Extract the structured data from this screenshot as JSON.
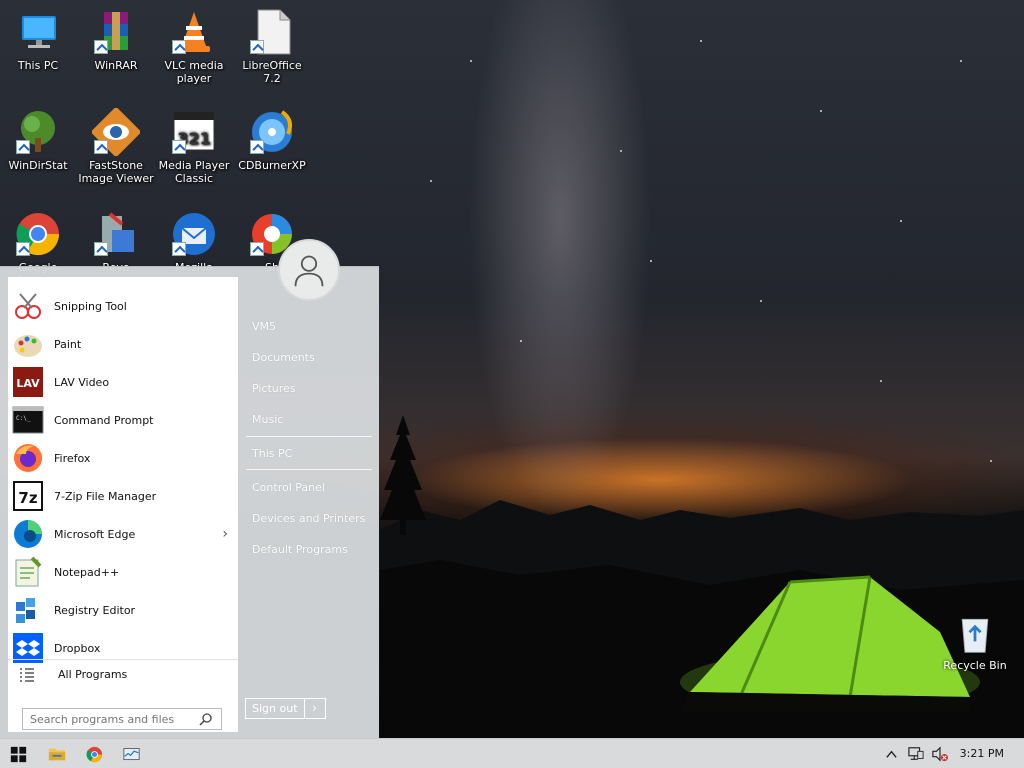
{
  "desktop": {
    "icons": [
      {
        "label": "This PC",
        "icon": "computer-icon"
      },
      {
        "label": "WinRAR",
        "icon": "winrar-icon"
      },
      {
        "label": "VLC media player",
        "icon": "vlc-icon"
      },
      {
        "label": "LibreOffice 7.2",
        "icon": "libreoffice-icon"
      },
      {
        "label": "WinDirStat",
        "icon": "windirstat-icon"
      },
      {
        "label": "FastStone Image Viewer",
        "icon": "faststone-icon"
      },
      {
        "label": "Media Player Classic",
        "icon": "mpc-icon"
      },
      {
        "label": "CDBurnerXP",
        "icon": "cdburner-icon"
      },
      {
        "label": "Google Chrome",
        "icon": "chrome-icon"
      },
      {
        "label": "Revo",
        "icon": "revo-icon"
      },
      {
        "label": "Mozilla",
        "icon": "thunderbird-icon"
      },
      {
        "label": "Sh",
        "icon": "sharex-icon"
      }
    ],
    "recycle_bin": "Recycle Bin"
  },
  "start_menu": {
    "programs": [
      {
        "label": "Snipping Tool",
        "icon": "scissors-icon"
      },
      {
        "label": "Paint",
        "icon": "paint-palette-icon"
      },
      {
        "label": "LAV Video",
        "icon": "lav-icon"
      },
      {
        "label": "Command Prompt",
        "icon": "terminal-icon"
      },
      {
        "label": "Firefox",
        "icon": "firefox-icon"
      },
      {
        "label": "7-Zip File Manager",
        "icon": "7zip-icon"
      },
      {
        "label": "Microsoft Edge",
        "icon": "edge-icon"
      },
      {
        "label": "Notepad++",
        "icon": "notepadpp-icon"
      },
      {
        "label": "Registry Editor",
        "icon": "regedit-icon"
      },
      {
        "label": "Dropbox",
        "icon": "dropbox-icon"
      }
    ],
    "all_programs": "All Programs",
    "search_placeholder": "Search programs and files",
    "right_links": {
      "user": "VM5",
      "documents": "Documents",
      "pictures": "Pictures",
      "music": "Music",
      "this_pc": "This PC",
      "control_panel": "Control Panel",
      "devices_printers": "Devices and Printers",
      "default_programs": "Default Programs"
    },
    "sign_out": "Sign out",
    "sign_out_arrow": "›"
  },
  "taskbar": {
    "clock": "3:21 PM"
  }
}
